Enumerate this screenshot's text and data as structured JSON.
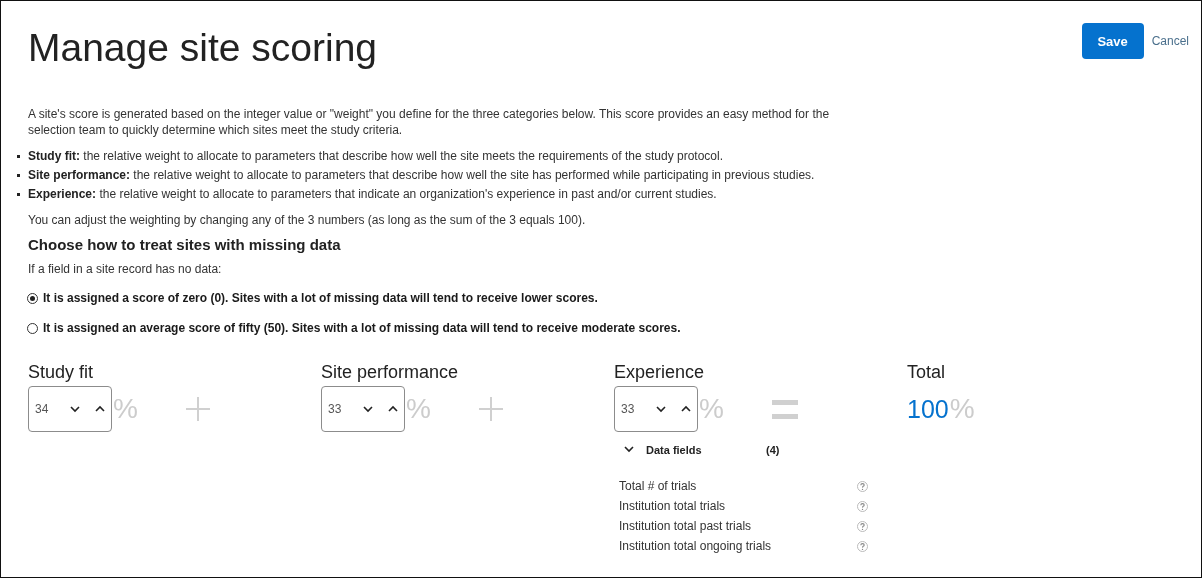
{
  "header": {
    "title": "Manage site scoring",
    "buttons": [
      {
        "label": "Save",
        "kind": "primary"
      },
      {
        "label": "Cancel",
        "kind": "link"
      }
    ]
  },
  "intro": "A site's score is generated based on the integer value or \"weight\" you define for the three categories below. This score provides an easy method for the selection team to quickly determine which sites meet the study criteria.",
  "bullets": [
    "**Study fit:** the relative weight to allocate to parameters that describe how well the site meets the requirements of the study protocol.",
    "**Site performance:** the relative weight to allocate to parameters that describe how well the site has performed while participating in previous studies.",
    "**Experience:** the relative weight to allocate to parameters that indicate an organization's experience in past and/or current studies."
  ],
  "adjust_note": "You can adjust the weighting by changing any of the 3 numbers (as long as the sum of the 3 equals 100).",
  "missing_data": {
    "heading": "Choose how to treat sites with missing data",
    "prompt": "If a field in a site record has no data:",
    "options": [
      {
        "label": "It is assigned a score of zero (0). Sites with a lot of missing data will tend to receive lower scores.",
        "selected": true
      },
      {
        "label": "It is assigned an average score of fifty (50). Sites with a lot of missing data will tend to receive moderate scores.",
        "selected": false
      }
    ]
  },
  "categories": [
    {
      "label": "Study fit",
      "value": "34",
      "unit": "%",
      "kind": "plus"
    },
    {
      "label": "Site performance",
      "value": "33",
      "unit": "%",
      "kind": "plus"
    },
    {
      "label": "Experience",
      "value": "33",
      "unit": "%",
      "kind": "equals",
      "data_fields": {
        "title": "Data fields",
        "count": "(4)",
        "expanded": true,
        "items": [
          "Total # of trials",
          "Institution total trials",
          "Institution total past trials",
          "Institution total ongoing trials"
        ]
      }
    }
  ],
  "total": {
    "label": "Total",
    "value": "100",
    "unit": "%"
  }
}
